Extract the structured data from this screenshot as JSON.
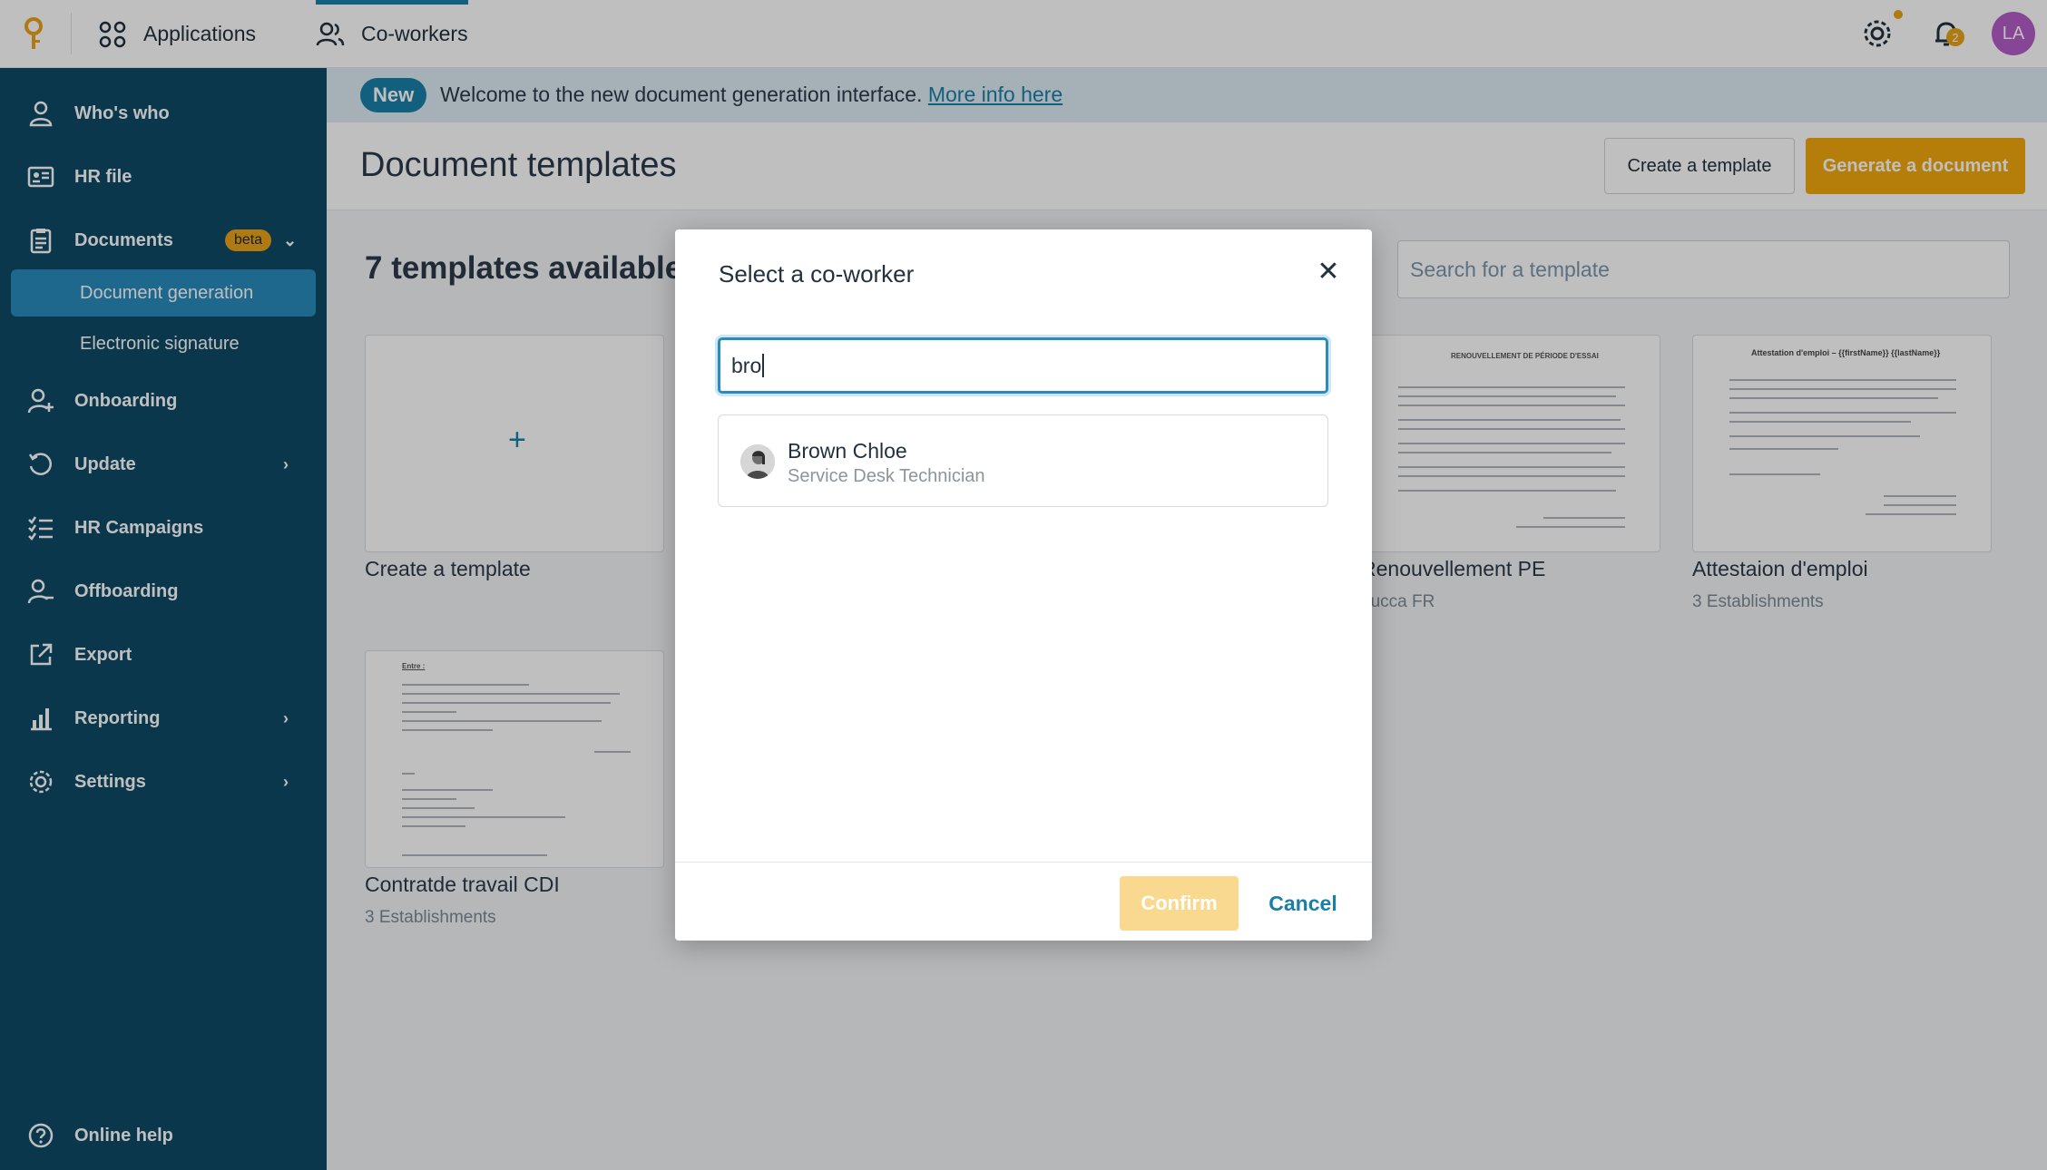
{
  "topbar": {
    "logo_icon": "key-lightbulb-logo",
    "nav": [
      {
        "label": "Applications",
        "icon": "grid-icon"
      },
      {
        "label": "Co-workers",
        "icon": "users-icon",
        "active": true
      }
    ],
    "settings_icon": "gear-icon",
    "notifications_icon": "bell-icon",
    "notification_count": "2",
    "avatar_initials": "LA"
  },
  "sidebar": {
    "items": [
      {
        "label": "Who's who",
        "icon": "person-icon"
      },
      {
        "label": "HR file",
        "icon": "id-card-icon"
      },
      {
        "label": "Documents",
        "icon": "clipboard-icon",
        "badge": "beta"
      },
      {
        "label": "Onboarding",
        "icon": "person-add-icon"
      },
      {
        "label": "Update",
        "icon": "refresh-icon"
      },
      {
        "label": "HR Campaigns",
        "icon": "checklist-icon"
      },
      {
        "label": "Offboarding",
        "icon": "person-remove-icon"
      },
      {
        "label": "Export",
        "icon": "external-link-icon"
      },
      {
        "label": "Reporting",
        "icon": "bar-chart-icon"
      },
      {
        "label": "Settings",
        "icon": "gear-icon"
      }
    ],
    "sub_items": [
      {
        "label": "Document generation",
        "active": true
      },
      {
        "label": "Electronic signature"
      }
    ],
    "help_label": "Online help"
  },
  "banner": {
    "pill": "New",
    "text": "Welcome to the new document generation interface.",
    "link": "More info here"
  },
  "header": {
    "title": "Document templates",
    "create_button": "Create a template",
    "generate_button": "Generate a document"
  },
  "templates": {
    "count_label": "7 templates available",
    "search_placeholder": "Search for a template",
    "cards": [
      {
        "title": "Create a template",
        "subtitle": ""
      },
      {
        "title": "Renouvellement PE",
        "subtitle": "Lucca FR"
      },
      {
        "title": "Attestaion d'emploi",
        "subtitle": "3 Establishments"
      },
      {
        "title": "Contratde travail CDI",
        "subtitle": "3 Establishments"
      }
    ],
    "card_preview_heading_1": "RENOUVELLEMENT DE PÉRIODE D'ESSAI",
    "card_preview_heading_2": "Attestation d'emploi – {{firstName}} {{lastName}}",
    "card_preview_heading_3": "Entre :"
  },
  "modal": {
    "title": "Select a co-worker",
    "close_icon": "close-icon",
    "search_value": "bro",
    "results": [
      {
        "name": "Brown Chloe",
        "role": "Service Desk Technician"
      }
    ],
    "confirm_label": "Confirm",
    "cancel_label": "Cancel"
  },
  "colors": {
    "sidebar_bg": "#0e4a66",
    "accent": "#1a7fa8",
    "primary_button": "#f2a70e",
    "beta_badge": "#e8a317",
    "avatar": "#b45cc8"
  }
}
